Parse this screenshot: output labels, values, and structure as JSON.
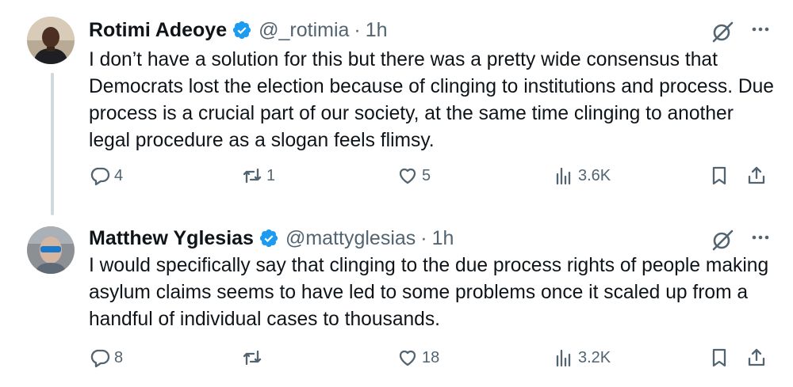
{
  "tweets": [
    {
      "name": "Rotimi Adeoye",
      "handle": "@_rotimia",
      "separator": "·",
      "time": "1h",
      "text": "I don’t have a solution for this but there was a pretty wide consensus that Democrats lost the election because of clinging to institutions and process. Due process is a crucial part of our society, at the same time clinging to another legal procedure as a slogan feels flimsy.",
      "replies": "4",
      "retweets": "1",
      "likes": "5",
      "views": "3.6K"
    },
    {
      "name": "Matthew Yglesias",
      "handle": "@mattyglesias",
      "separator": "·",
      "time": "1h",
      "text": "I would specifically say that clinging to the due process rights of people making asylum claims seems to have led to some problems once it scaled up from a handful of individual cases to thousands.",
      "replies": "8",
      "retweets": "",
      "likes": "18",
      "views": "3.2K"
    }
  ],
  "colors": {
    "text": "#0f1419",
    "muted": "#536471",
    "verified": "#1d9bf0",
    "thread_line": "#cfd9de"
  },
  "icons": [
    "reply-icon",
    "retweet-icon",
    "like-icon",
    "views-icon",
    "bookmark-icon",
    "share-icon",
    "grok-icon",
    "more-icon",
    "verified-badge-icon"
  ]
}
